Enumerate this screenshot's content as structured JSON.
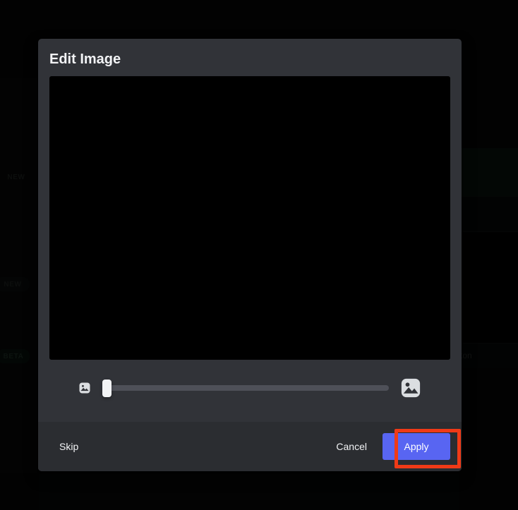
{
  "window": {
    "background_color": "#070808"
  },
  "backdrop": {
    "description": "Dimmed application behind the modal overlay",
    "sidebar_badges": [
      {
        "label": "NEW",
        "style": "plain"
      },
      {
        "label": "NEW",
        "style": "pill"
      },
      {
        "label": "BETA",
        "style": "greenish"
      }
    ],
    "right_cards": [
      {
        "style": "green",
        "text": ""
      },
      {
        "style": "dark",
        "text": ""
      },
      {
        "style": "black",
        "text": ""
      },
      {
        "style": "dark",
        "text": "ton"
      }
    ]
  },
  "modal": {
    "title": "Edit Image",
    "preview": {
      "name": "image-preview",
      "background_color": "#000000",
      "content": ""
    },
    "zoom_control": {
      "min_icon": "image-icon-small",
      "max_icon": "image-icon-large",
      "value": 0,
      "min": 0,
      "max": 100
    },
    "footer": {
      "skip_label": "Skip",
      "cancel_label": "Cancel",
      "apply_label": "Apply",
      "apply_color": "#5865F2"
    }
  },
  "annotation": {
    "highlight_color": "#F03A17",
    "target": "apply-button"
  }
}
